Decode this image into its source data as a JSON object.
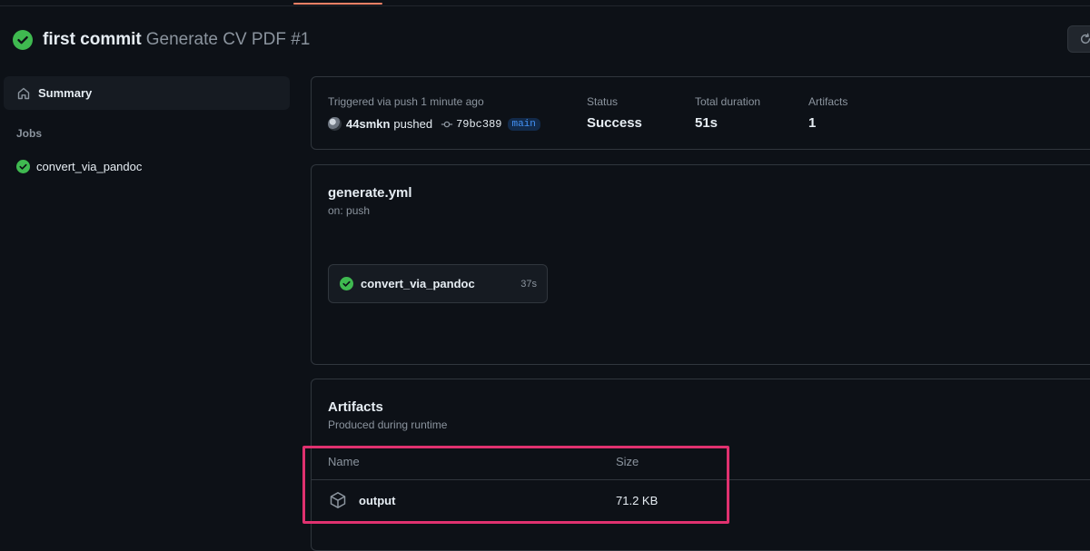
{
  "header": {
    "title": "first commit",
    "subtitle": "Generate CV PDF #1",
    "status_icon": "check-circle-icon"
  },
  "sidebar": {
    "summary_label": "Summary",
    "jobs_heading": "Jobs",
    "jobs": [
      {
        "label": "convert_via_pandoc",
        "status": "success"
      }
    ]
  },
  "run": {
    "triggered_text": "Triggered via push 1 minute ago",
    "actor": "44smkn",
    "action": "pushed",
    "commit_sha": "79bc389",
    "branch": "main",
    "status_label": "Status",
    "status_value": "Success",
    "duration_label": "Total duration",
    "duration_value": "51s",
    "artifacts_label": "Artifacts",
    "artifacts_count": "1"
  },
  "workflow": {
    "file": "generate.yml",
    "trigger": "on: push",
    "job": {
      "name": "convert_via_pandoc",
      "duration": "37s"
    }
  },
  "artifacts": {
    "title": "Artifacts",
    "subtitle": "Produced during runtime",
    "columns": {
      "name": "Name",
      "size": "Size"
    },
    "items": [
      {
        "name": "output",
        "size": "71.2 KB"
      }
    ]
  },
  "colors": {
    "success": "#3fb950",
    "accent": "#f78166",
    "highlight": "#e0316f",
    "branch": "#4493f8"
  }
}
